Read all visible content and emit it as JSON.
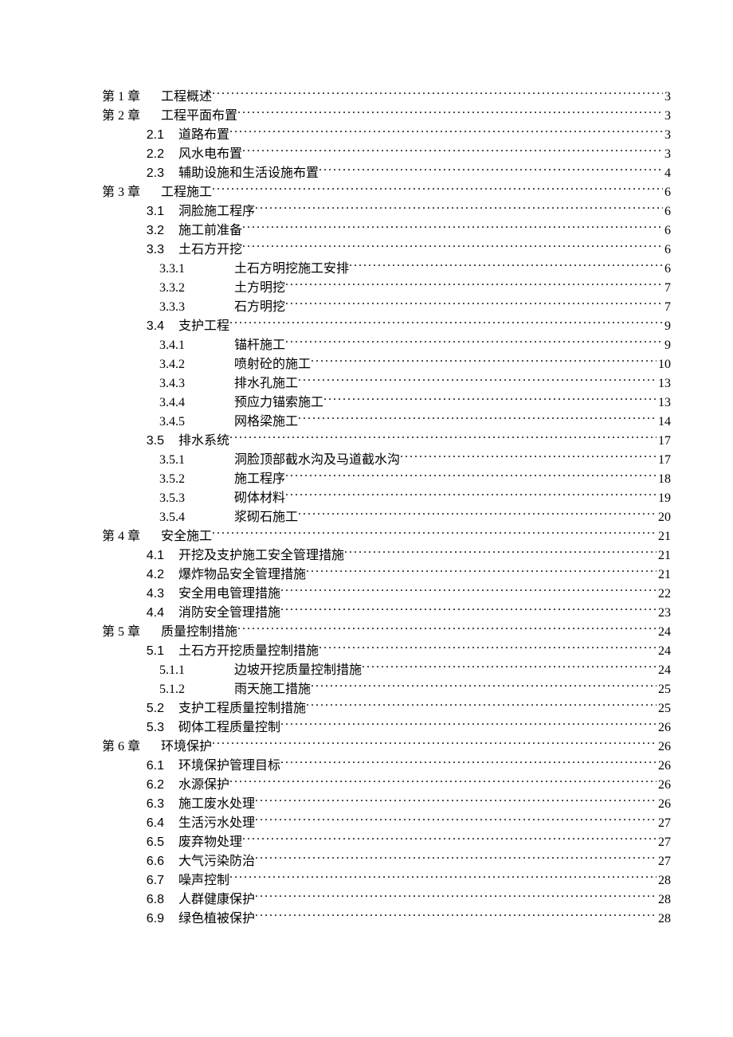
{
  "toc": [
    {
      "level": 1,
      "num": "第 1 章",
      "title": "工程概述",
      "page": "3",
      "numClass": "num-chapter"
    },
    {
      "level": 1,
      "num": "第 2 章",
      "title": "工程平面布置",
      "page": "3",
      "numClass": "num-chapter"
    },
    {
      "level": 2,
      "num": "2.1",
      "title": "道路布置",
      "page": "3",
      "numClass": "num-section"
    },
    {
      "level": 2,
      "num": "2.2",
      "title": "风水电布置",
      "page": "3",
      "numClass": "num-section"
    },
    {
      "level": 2,
      "num": "2.3",
      "title": "辅助设施和生活设施布置",
      "page": "4",
      "numClass": "num-section"
    },
    {
      "level": 1,
      "num": "第 3 章",
      "title": "工程施工",
      "page": "6",
      "numClass": "num-chapter"
    },
    {
      "level": 2,
      "num": "3.1",
      "title": "洞脸施工程序",
      "page": "6",
      "numClass": "num-section"
    },
    {
      "level": 2,
      "num": "3.2",
      "title": "施工前准备",
      "page": "6",
      "numClass": "num-section"
    },
    {
      "level": 2,
      "num": "3.3",
      "title": "土石方开挖",
      "page": "6",
      "numClass": "num-section"
    },
    {
      "level": 3,
      "num": "3.3.1",
      "title": "土石方明挖施工安排",
      "page": "6",
      "numClass": "num-sub"
    },
    {
      "level": 3,
      "num": "3.3.2",
      "title": "土方明挖",
      "page": "7",
      "numClass": "num-sub"
    },
    {
      "level": 3,
      "num": "3.3.3",
      "title": "石方明挖",
      "page": "7",
      "numClass": "num-sub"
    },
    {
      "level": 2,
      "num": "3.4",
      "title": "支护工程",
      "page": "9",
      "numClass": "num-section"
    },
    {
      "level": 3,
      "num": "3.4.1",
      "title": "锚杆施工",
      "page": "9",
      "numClass": "num-sub"
    },
    {
      "level": 3,
      "num": "3.4.2",
      "title": "喷射砼的施工",
      "page": "10",
      "numClass": "num-sub"
    },
    {
      "level": 3,
      "num": "3.4.3",
      "title": "排水孔施工",
      "page": "13",
      "numClass": "num-sub"
    },
    {
      "level": 3,
      "num": "3.4.4",
      "title": "预应力锚索施工",
      "page": "13",
      "numClass": "num-sub"
    },
    {
      "level": 3,
      "num": "3.4.5",
      "title": "网格梁施工",
      "page": "14",
      "numClass": "num-sub"
    },
    {
      "level": 2,
      "num": "3.5",
      "title": "排水系统",
      "page": "17",
      "numClass": "num-section"
    },
    {
      "level": 3,
      "num": "3.5.1",
      "title": "洞脸顶部截水沟及马道截水沟",
      "page": "17",
      "numClass": "num-sub"
    },
    {
      "level": 3,
      "num": "3.5.2",
      "title": "施工程序",
      "page": "18",
      "numClass": "num-sub"
    },
    {
      "level": 3,
      "num": "3.5.3",
      "title": "砌体材料",
      "page": "19",
      "numClass": "num-sub"
    },
    {
      "level": 3,
      "num": "3.5.4",
      "title": "浆砌石施工",
      "page": "20",
      "numClass": "num-sub"
    },
    {
      "level": 1,
      "num": "第 4 章",
      "title": "安全施工",
      "page": "21",
      "numClass": "num-chapter"
    },
    {
      "level": 2,
      "num": "4.1",
      "title": "开挖及支护施工安全管理措施",
      "page": "21",
      "numClass": "num-section"
    },
    {
      "level": 2,
      "num": "4.2",
      "title": "爆炸物品安全管理措施",
      "page": "21",
      "numClass": "num-section"
    },
    {
      "level": 2,
      "num": "4.3",
      "title": "安全用电管理措施",
      "page": "22",
      "numClass": "num-section"
    },
    {
      "level": 2,
      "num": "4.4",
      "title": "消防安全管理措施",
      "page": "23",
      "numClass": "num-section"
    },
    {
      "level": 1,
      "num": "第 5 章",
      "title": "质量控制措施",
      "page": "24",
      "numClass": "num-chapter"
    },
    {
      "level": 2,
      "num": "5.1",
      "title": "土石方开挖质量控制措施",
      "page": "24",
      "numClass": "num-section"
    },
    {
      "level": 3,
      "num": "5.1.1",
      "title": "边坡开挖质量控制措施",
      "page": "24",
      "numClass": "num-sub"
    },
    {
      "level": 3,
      "num": "5.1.2",
      "title": "雨天施工措施",
      "page": "25",
      "numClass": "num-sub"
    },
    {
      "level": 2,
      "num": "5.2",
      "title": "支护工程质量控制措施",
      "page": "25",
      "numClass": "num-section"
    },
    {
      "level": 2,
      "num": "5.3",
      "title": "砌体工程质量控制",
      "page": "26",
      "numClass": "num-section"
    },
    {
      "level": 1,
      "num": "第 6 章",
      "title": "环境保护",
      "page": "26",
      "numClass": "num-chapter"
    },
    {
      "level": 2,
      "num": "6.1",
      "title": "环境保护管理目标",
      "page": "26",
      "numClass": "num-section"
    },
    {
      "level": 2,
      "num": "6.2",
      "title": "水源保护",
      "page": "26",
      "numClass": "num-section"
    },
    {
      "level": 2,
      "num": "6.3",
      "title": "施工废水处理",
      "page": "26",
      "numClass": "num-section"
    },
    {
      "level": 2,
      "num": "6.4",
      "title": "生活污水处理",
      "page": "27",
      "numClass": "num-section"
    },
    {
      "level": 2,
      "num": "6.5",
      "title": "废弃物处理",
      "page": "27",
      "numClass": "num-section"
    },
    {
      "level": 2,
      "num": "6.6",
      "title": "大气污染防治",
      "page": "27",
      "numClass": "num-section"
    },
    {
      "level": 2,
      "num": "6.7",
      "title": "噪声控制",
      "page": "28",
      "numClass": "num-section"
    },
    {
      "level": 2,
      "num": "6.8",
      "title": "人群健康保护",
      "page": "28",
      "numClass": "num-section"
    },
    {
      "level": 2,
      "num": "6.9",
      "title": "绿色植被保护",
      "page": "28",
      "numClass": "num-section"
    }
  ]
}
